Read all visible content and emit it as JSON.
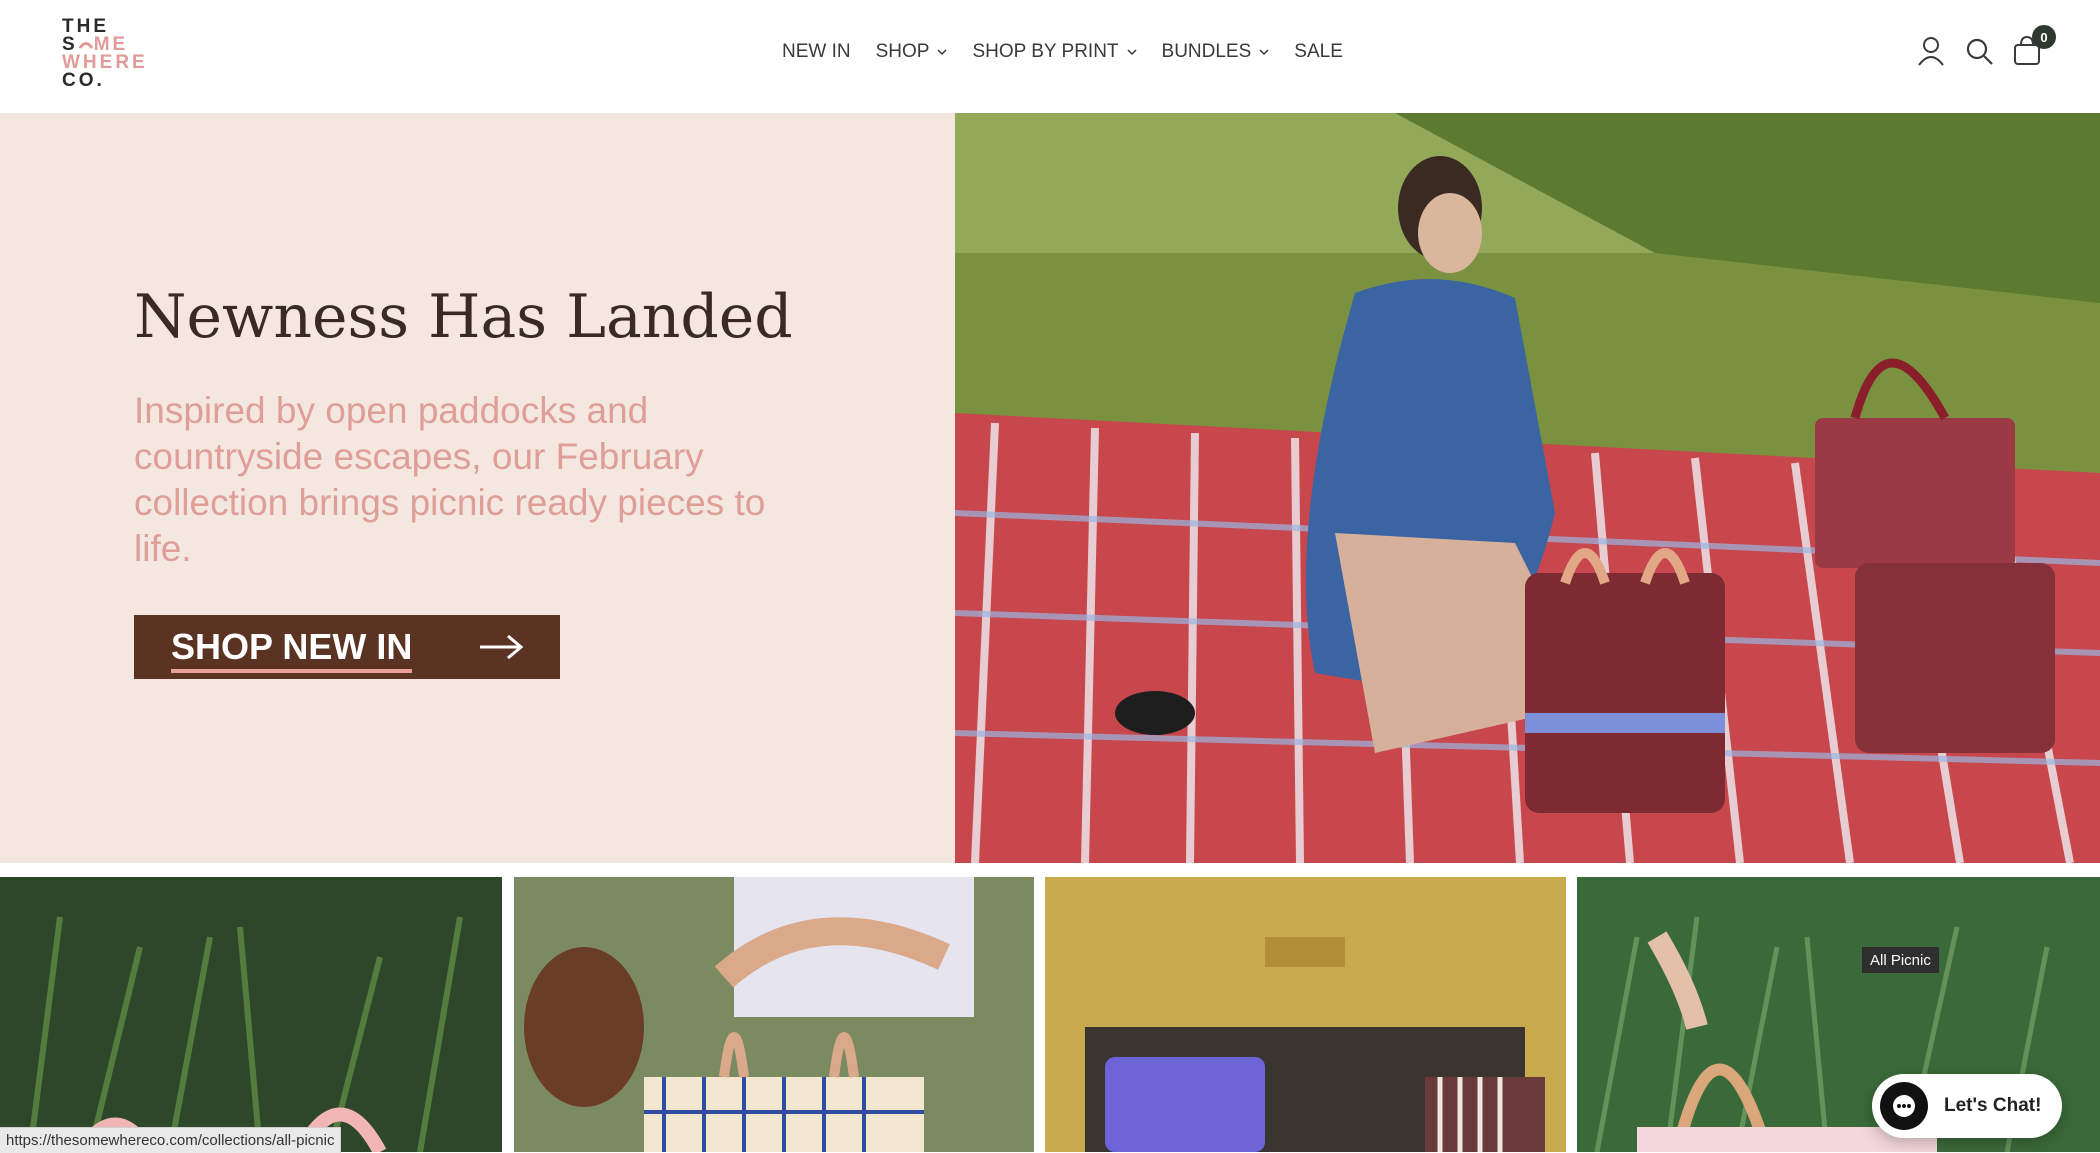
{
  "header": {
    "logo": {
      "line1": "THE",
      "line2a": "S",
      "line2b": "ME",
      "line3": "WHERE",
      "line4": "CO."
    },
    "nav": [
      {
        "label": "NEW IN",
        "has_dropdown": false
      },
      {
        "label": "SHOP",
        "has_dropdown": true
      },
      {
        "label": "SHOP BY PRINT",
        "has_dropdown": true
      },
      {
        "label": "BUNDLES",
        "has_dropdown": true
      },
      {
        "label": "SALE",
        "has_dropdown": false
      }
    ],
    "icons": [
      "account-icon",
      "search-icon",
      "cart-icon"
    ],
    "cart_count": "0"
  },
  "hero": {
    "title": "Newness Has Landed",
    "subtitle": "Inspired by open paddocks and countryside escapes, our February collection brings picnic ready pieces to life.",
    "button_label": "SHOP NEW IN"
  },
  "tooltip": "All Picnic",
  "chat_label": "Let's Chat!",
  "status_url": "https://thesomewhereco.com/collections/all-picnic",
  "colors": {
    "hero_bg": "#f3e7e0",
    "title": "#3a2a24",
    "subtitle": "#df9e98",
    "button_bg": "#5a3322",
    "underline": "#e7a09c"
  }
}
